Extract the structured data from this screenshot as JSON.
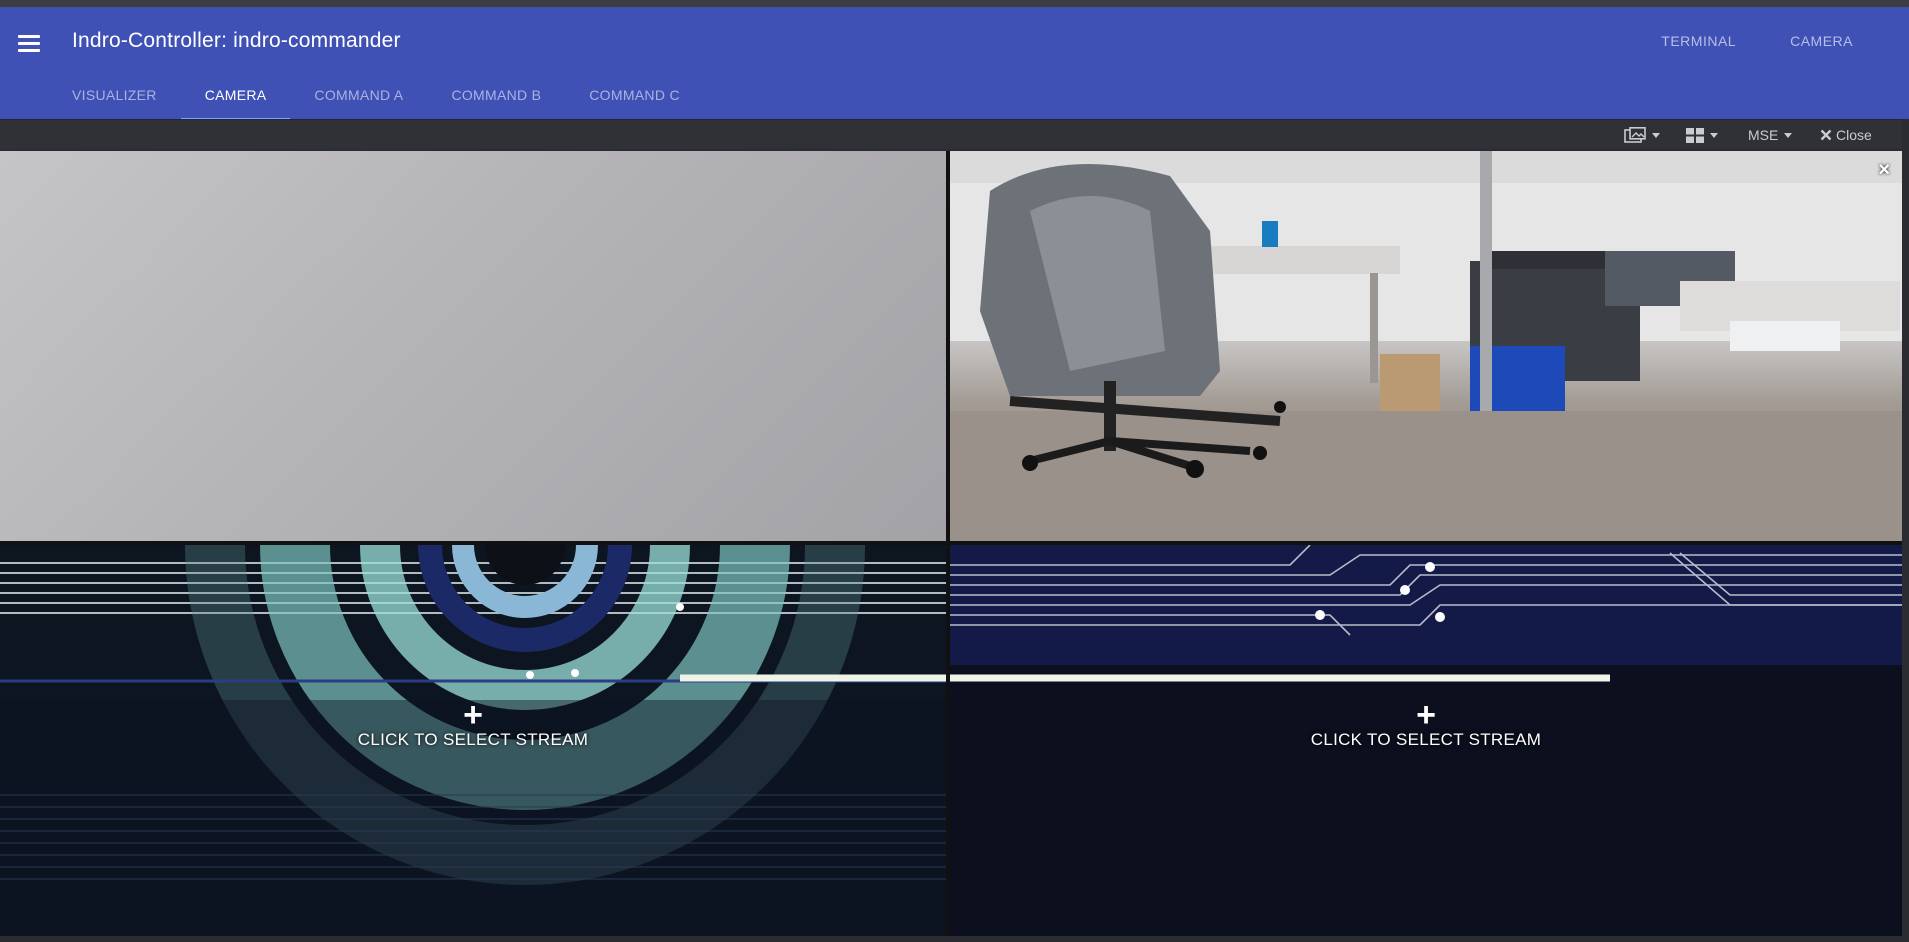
{
  "appbar": {
    "title": "Indro-Controller: indro-commander",
    "links": [
      "TERMINAL",
      "CAMERA"
    ],
    "tabs": [
      "VISUALIZER",
      "CAMERA",
      "COMMAND A",
      "COMMAND B",
      "COMMAND C"
    ],
    "active_tab": "CAMERA",
    "color": "#3f51b5"
  },
  "toolbar": {
    "mode_label": "MSE",
    "close_label": "Close",
    "icons": [
      "picture-in-picture-icon",
      "grid-layout-icon",
      "close-icon"
    ]
  },
  "streams": {
    "select_label": "CLICK TO SELECT STREAM",
    "cell_close": "×"
  }
}
